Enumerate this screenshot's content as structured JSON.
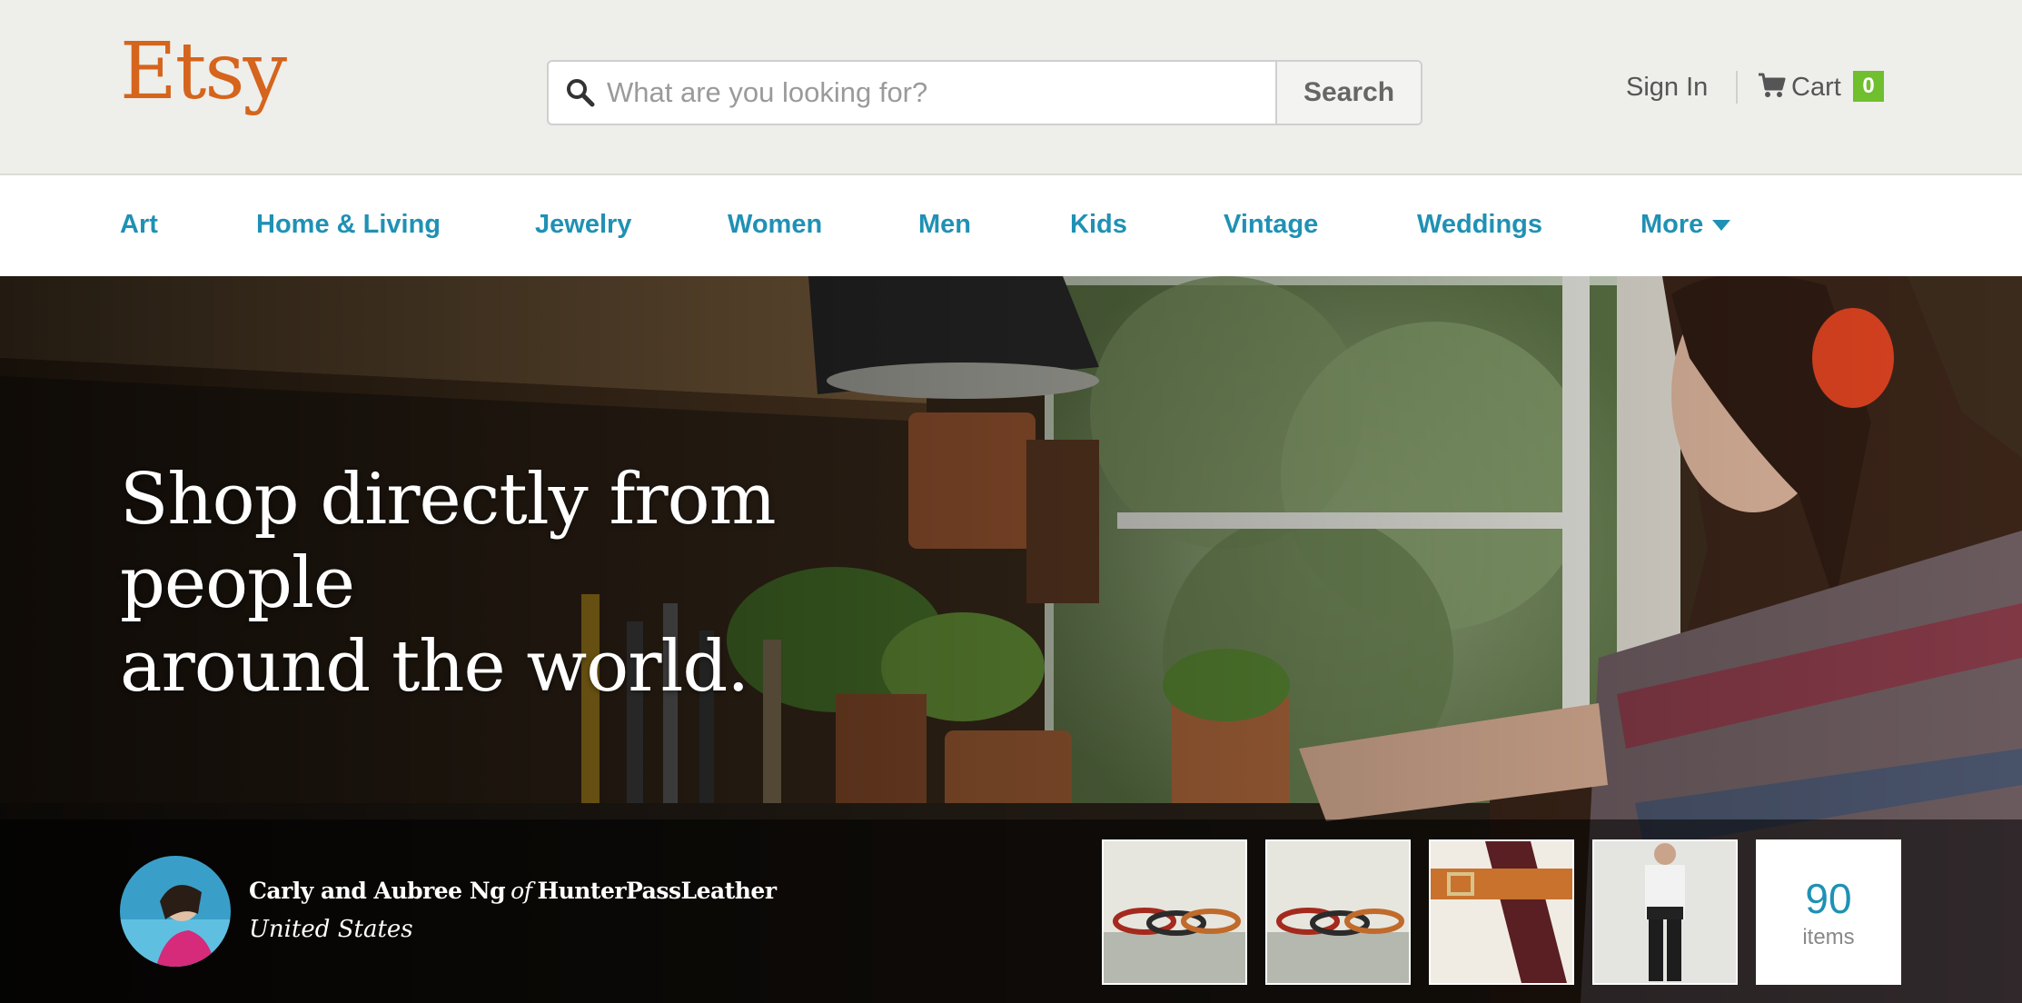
{
  "brand": {
    "logo_text": "Etsy",
    "color": "#d5641c"
  },
  "search": {
    "placeholder": "What are you looking for?",
    "value": "",
    "button_label": "Search"
  },
  "account": {
    "sign_in_label": "Sign In",
    "cart_label": "Cart",
    "cart_count": "0"
  },
  "nav": {
    "items": [
      {
        "label": "Art"
      },
      {
        "label": "Home & Living"
      },
      {
        "label": "Jewelry"
      },
      {
        "label": "Women"
      },
      {
        "label": "Men"
      },
      {
        "label": "Kids"
      },
      {
        "label": "Vintage"
      },
      {
        "label": "Weddings"
      },
      {
        "label": "More"
      }
    ],
    "color": "#1f91b4"
  },
  "hero": {
    "heading_line1": "Shop directly from people",
    "heading_line2": "around the world.",
    "seller": {
      "name": "Carly and Aubree Ng",
      "connector": "of",
      "shop": "HunterPassLeather",
      "location": "United States"
    },
    "items": {
      "count": "90",
      "label": "items"
    }
  },
  "icons": [
    "search-icon",
    "cart-icon",
    "chevron-down-icon"
  ]
}
